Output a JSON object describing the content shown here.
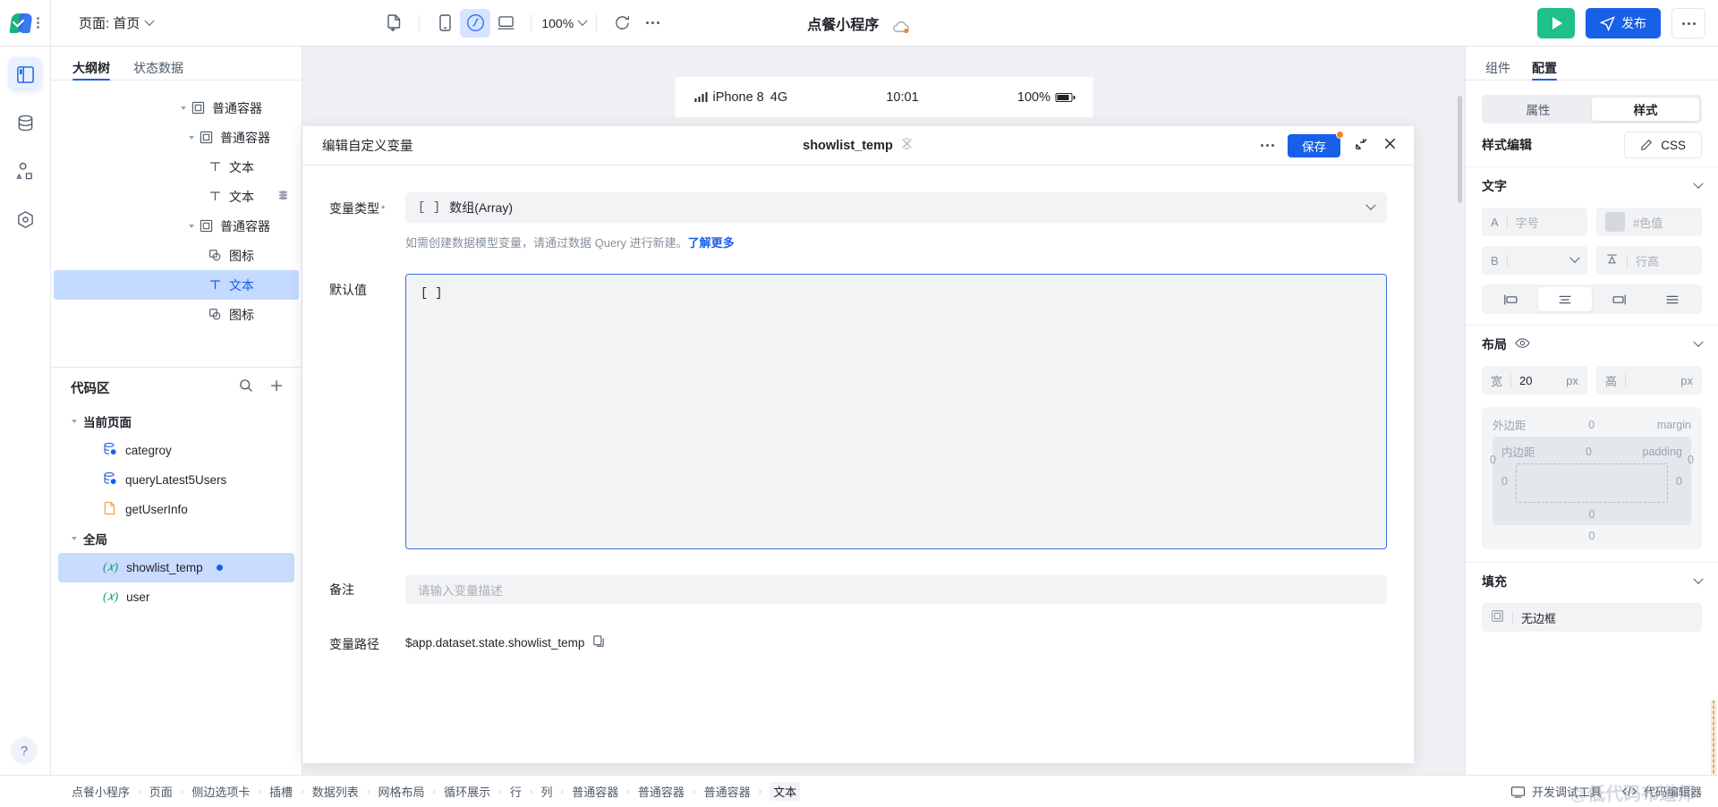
{
  "topbar": {
    "page_selector_label": "页面: 首页",
    "zoom_level": "100%",
    "app_title": "点餐小程序",
    "publish_label": "发布",
    "icons": {
      "new_page": "new-page-icon",
      "mobile": "mobile-device-icon",
      "mini_program": "mini-program-icon",
      "desktop": "desktop-device-icon",
      "refresh": "refresh-icon",
      "more": "more-horizontal-icon",
      "run": "run-icon",
      "cloud": "cloud-status-icon"
    }
  },
  "left_panel": {
    "tabs": [
      {
        "label": "大纲树",
        "active": true
      },
      {
        "label": "状态数据",
        "active": false
      }
    ],
    "tree": [
      {
        "label": "普通容器",
        "depth": 0,
        "icon": "container-icon",
        "expandable": true,
        "selected": false,
        "badge": false
      },
      {
        "label": "普通容器",
        "depth": 1,
        "icon": "container-icon",
        "expandable": true,
        "selected": false,
        "badge": false
      },
      {
        "label": "文本",
        "depth": 2,
        "icon": "text-icon",
        "expandable": false,
        "selected": false,
        "badge": false
      },
      {
        "label": "文本",
        "depth": 2,
        "icon": "text-icon",
        "expandable": false,
        "selected": false,
        "badge": true
      },
      {
        "label": "普通容器",
        "depth": 1,
        "icon": "container-icon",
        "expandable": true,
        "selected": false,
        "badge": false
      },
      {
        "label": "图标",
        "depth": 2,
        "icon": "shape-icon",
        "expandable": false,
        "selected": false,
        "badge": false
      },
      {
        "label": "文本",
        "depth": 2,
        "icon": "text-icon",
        "expandable": false,
        "selected": true,
        "badge": false
      },
      {
        "label": "图标",
        "depth": 2,
        "icon": "shape-icon",
        "expandable": false,
        "selected": false,
        "badge": false
      }
    ],
    "code_section": {
      "title": "代码区",
      "groups": [
        {
          "label": "当前页面",
          "items": [
            {
              "label": "categroy",
              "icon": "query-icon",
              "selected": false,
              "modified": false
            },
            {
              "label": "queryLatest5Users",
              "icon": "query-icon",
              "selected": false,
              "modified": false
            },
            {
              "label": "getUserInfo",
              "icon": "js-file-icon",
              "selected": false,
              "modified": false
            }
          ]
        },
        {
          "label": "全局",
          "items": [
            {
              "label": "showlist_temp",
              "icon": "variable-icon",
              "selected": true,
              "modified": true
            },
            {
              "label": "user",
              "icon": "variable-icon",
              "selected": false,
              "modified": false
            }
          ]
        }
      ]
    }
  },
  "canvas": {
    "device_status": {
      "device": "iPhone 8",
      "network": "4G",
      "time": "10:01",
      "battery_percent": "100%"
    }
  },
  "modal": {
    "title": "编辑自定义变量",
    "variable_name": "showlist_temp",
    "save_label": "保存",
    "fields": {
      "type_label": "变量类型",
      "type_value": "数组(Array)",
      "type_prefix": "[ ]",
      "hint_text": "如需创建数据模型变量，请通过数据 Query 进行新建。",
      "hint_link": "了解更多",
      "default_label": "默认值",
      "default_value": "[ ]",
      "remark_label": "备注",
      "remark_placeholder": "请输入变量描述",
      "path_label": "变量路径",
      "path_value": "$app.dataset.state.showlist_temp"
    }
  },
  "right_panel": {
    "tabs": [
      {
        "label": "组件",
        "active": false
      },
      {
        "label": "配置",
        "active": true
      }
    ],
    "segment": [
      {
        "label": "属性",
        "active": false
      },
      {
        "label": "样式",
        "active": true
      }
    ],
    "style_edit_label": "样式编辑",
    "css_button_label": "CSS",
    "sections": {
      "text": {
        "title": "文字",
        "font_size_prefix": "A",
        "font_size_placeholder": "字号",
        "color_placeholder": "#色值",
        "weight_prefix": "B",
        "weight_value": "",
        "lineheight_placeholder": "行高",
        "align_options": [
          "align-left",
          "align-center",
          "align-right",
          "align-justify"
        ],
        "align_active": 1
      },
      "layout": {
        "title": "布局",
        "width_label": "宽",
        "width_value": "20",
        "width_unit": "px",
        "height_label": "高",
        "height_value": "",
        "height_unit": "px",
        "margin_label": "外边距",
        "margin_en": "margin",
        "padding_label": "内边距",
        "padding_en": "padding",
        "margin_top": "0",
        "margin_right": "0",
        "margin_bottom": "0",
        "margin_left": "0",
        "padding_top": "0",
        "padding_right": "0",
        "padding_bottom": "0",
        "padding_left": "0"
      },
      "fill": {
        "title": "填充",
        "border_option": "无边框"
      }
    }
  },
  "footer": {
    "breadcrumb": [
      "点餐小程序",
      "页面",
      "侧边选项卡",
      "插槽",
      "数据列表",
      "网格布局",
      "循环展示",
      "行",
      "列",
      "普通容器",
      "普通容器",
      "普通容器",
      "文本"
    ],
    "debug_tool_label": "开发调试工具",
    "code_editor_label": "代码编辑器",
    "watermark": "@低代码布道师"
  }
}
